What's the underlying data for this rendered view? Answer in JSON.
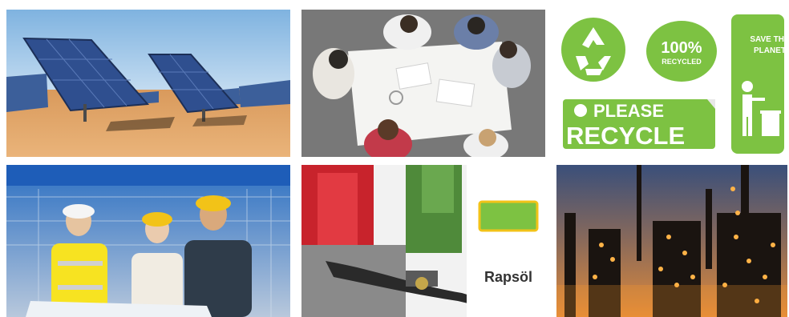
{
  "tiles": [
    {
      "subject": "solar-panels"
    },
    {
      "subject": "business-meeting"
    },
    {
      "subject": "recycling-stickers"
    },
    {
      "subject": "construction-workers"
    },
    {
      "subject": "fuel-pump-rapsoel"
    },
    {
      "subject": "refinery-at-night"
    }
  ],
  "recycle": {
    "sticker_100": "100%",
    "sticker_recycled": "RECYCLED",
    "please": "PLEASE",
    "recycle": "RECYCLE",
    "save_the": "SAVE THE",
    "planet": "PLANET"
  },
  "fuel": {
    "brand": "Rapsöl"
  },
  "colors": {
    "recycle_green": "#7dc242",
    "sky_blue": "#9ec7ea",
    "desert_sand": "#e4a060",
    "refinery_glow": "#ffb347",
    "hardhat_yellow": "#f2c318"
  }
}
